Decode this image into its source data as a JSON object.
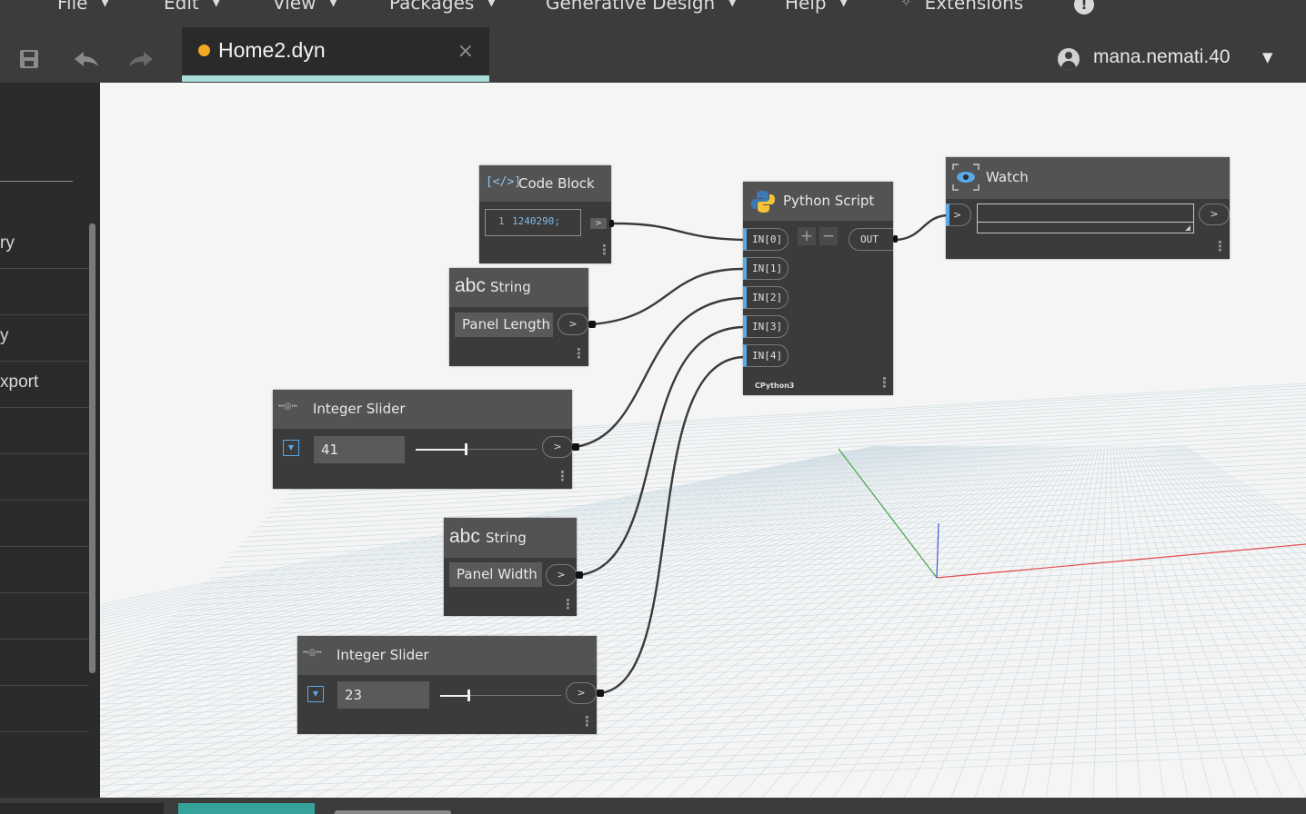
{
  "menu": {
    "items": [
      {
        "label": "File"
      },
      {
        "label": "Edit"
      },
      {
        "label": "View"
      },
      {
        "label": "Packages"
      },
      {
        "label": "Generative Design"
      },
      {
        "label": "Help"
      },
      {
        "label": "Extensions"
      }
    ],
    "caret": "▼"
  },
  "toolbar": {
    "save_icon": "save-icon",
    "undo_icon": "undo-icon",
    "redo_icon": "redo-icon"
  },
  "tab": {
    "title": "Home2.dyn",
    "close": "×",
    "unsaved_color": "#f5a623"
  },
  "user": {
    "name": "mana.nemati.40",
    "caret": "▼"
  },
  "sidebar": {
    "items": [
      "ry",
      "",
      "y",
      "xport",
      "",
      "",
      "",
      "",
      "",
      "",
      ""
    ]
  },
  "nodes": {
    "code_block": {
      "title": "Code Block",
      "line_number": "1",
      "code": "1240290;",
      "out": ">"
    },
    "string1": {
      "title": "String",
      "icon_text": "abc",
      "value": "Panel Length",
      "out": ">"
    },
    "slider1": {
      "title": "Integer Slider",
      "value": "41",
      "level": 0.41,
      "out": ">"
    },
    "string2": {
      "title": "String",
      "icon_text": "abc",
      "value": "Panel Width",
      "out": ">"
    },
    "slider2": {
      "title": "Integer Slider",
      "value": "23",
      "level": 0.23,
      "out": ">"
    },
    "python": {
      "title": "Python Script",
      "inputs": [
        "IN[0]",
        "IN[1]",
        "IN[2]",
        "IN[3]",
        "IN[4]"
      ],
      "output": "OUT",
      "plus": "+",
      "minus": "−",
      "engine": "CPython3"
    },
    "watch": {
      "title": "Watch",
      "in": ">",
      "out": ">"
    }
  },
  "colors": {
    "accent": "#a8ddd9",
    "port_blue": "#5aa9e6"
  }
}
